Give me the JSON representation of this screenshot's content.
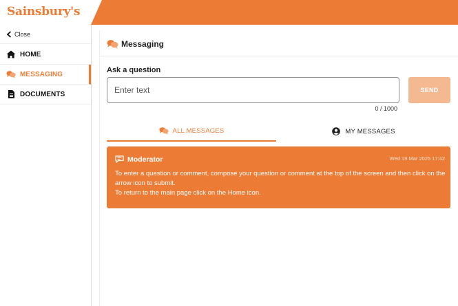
{
  "header": {
    "logo_text": "Sainsbury's",
    "accent_color": "#ec7b35"
  },
  "sidebar": {
    "close_label": "Close",
    "items": [
      {
        "label": "HOME",
        "icon": "home-icon",
        "active": false
      },
      {
        "label": "MESSAGING",
        "icon": "chat-bubbles-icon",
        "active": true
      },
      {
        "label": "DOCUMENTS",
        "icon": "document-icon",
        "active": false
      }
    ]
  },
  "main": {
    "title": "Messaging",
    "ask_label": "Ask a question",
    "input_placeholder": "Enter text",
    "input_value": "",
    "send_label": "SEND",
    "char_count": "0 / 1000",
    "tabs": [
      {
        "label": "ALL MESSAGES",
        "icon": "chat-bubbles-icon",
        "active": true
      },
      {
        "label": "MY MESSAGES",
        "icon": "user-circle-icon",
        "active": false
      }
    ],
    "messages": [
      {
        "author": "Moderator",
        "timestamp": "Wed 19 Mar 2025 17:42",
        "icon": "speech-icon",
        "body_lines": [
          "To enter a question or comment, compose your question or comment at the top of the screen and then click on the arrow icon to submit.",
          "To return to the main page click on the Home icon."
        ]
      }
    ]
  }
}
